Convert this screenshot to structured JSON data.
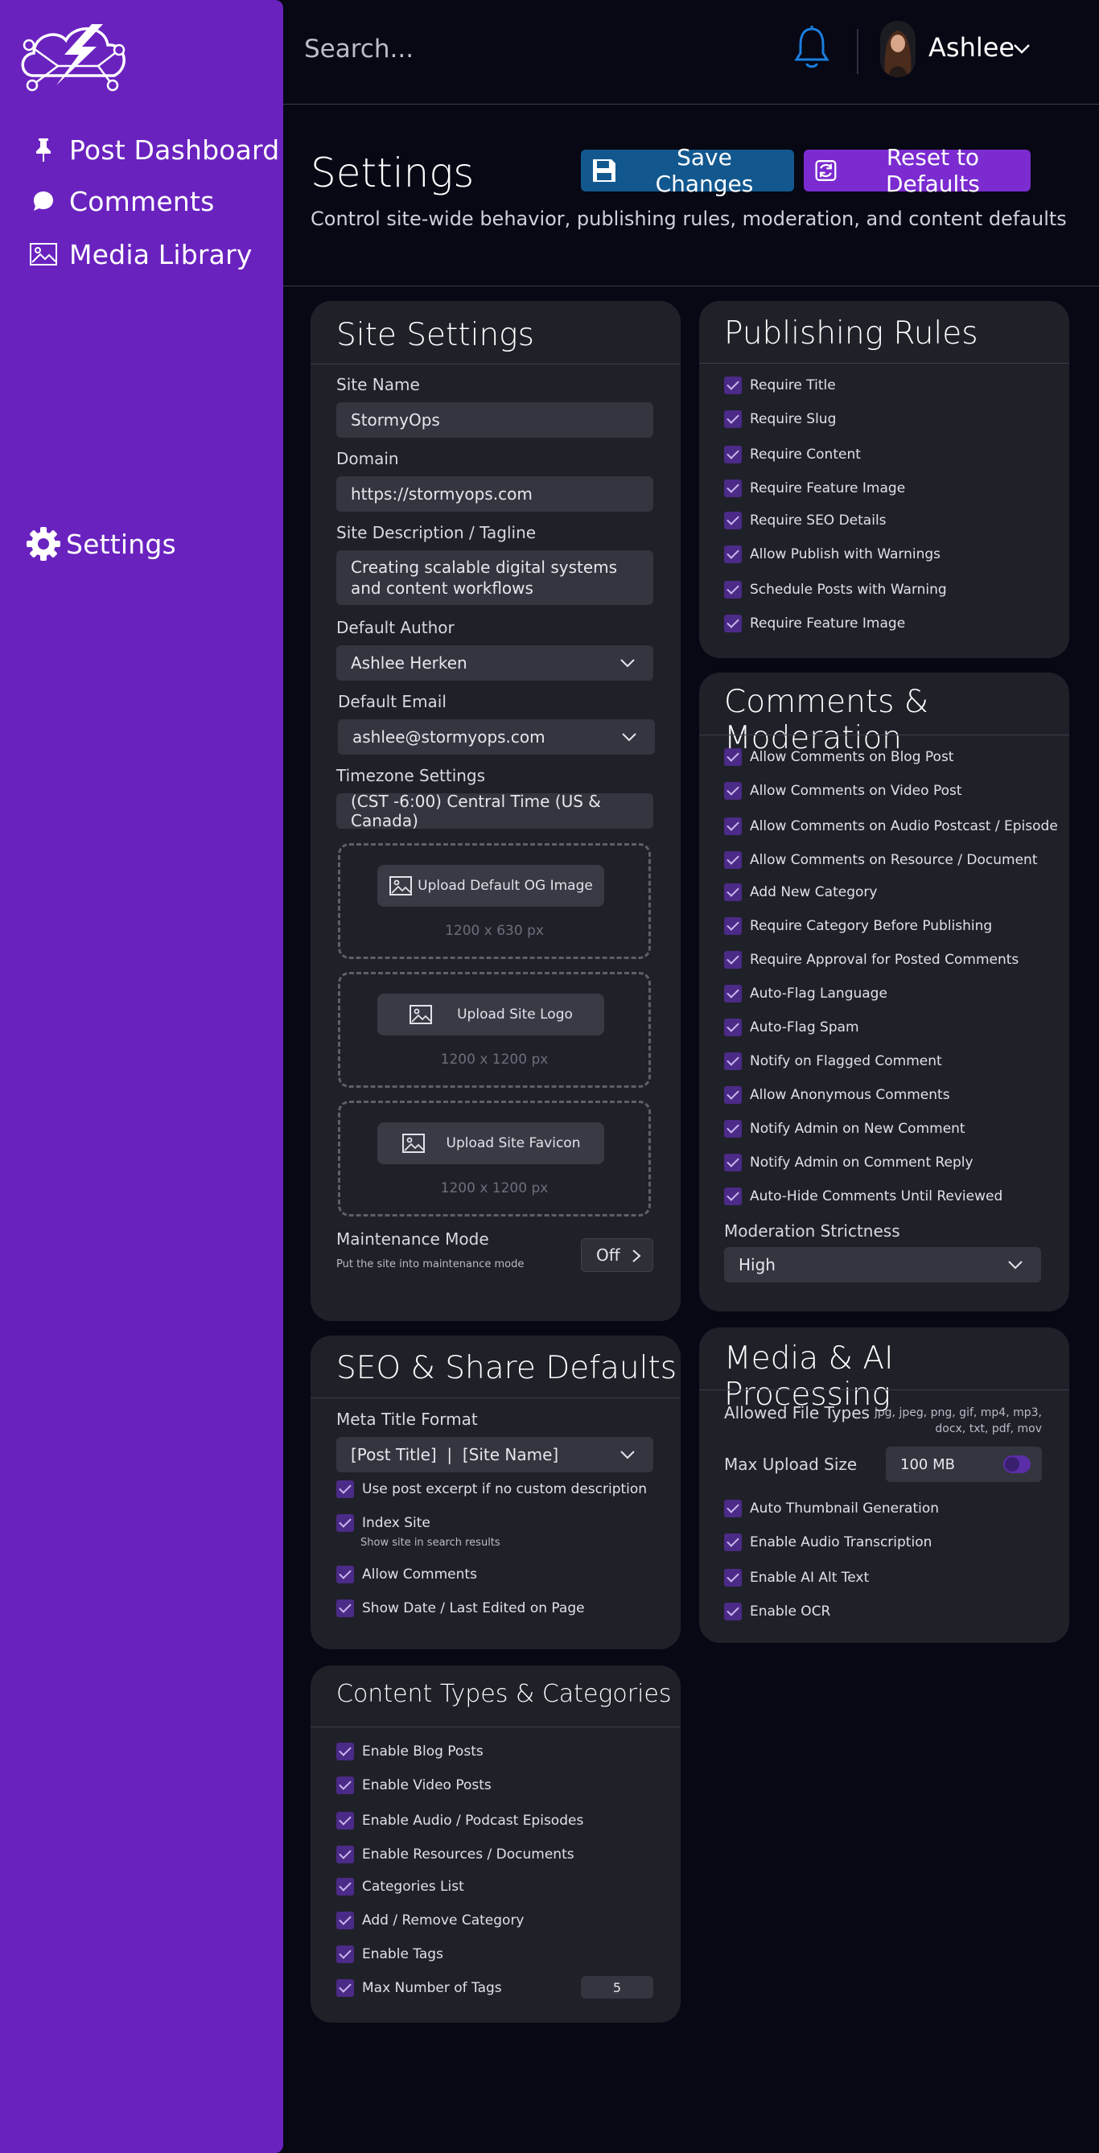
{
  "sidebar": {
    "items": [
      {
        "label": "Post Dashboard",
        "icon": "pin-icon"
      },
      {
        "label": "Comments",
        "icon": "speech-bubble-icon"
      },
      {
        "label": "Media Library",
        "icon": "image-icon"
      },
      {
        "label": "Settings",
        "icon": "gear-icon"
      }
    ]
  },
  "header": {
    "search_placeholder": "Search...",
    "user_name": "Ashlee"
  },
  "page": {
    "title": "Settings",
    "subtitle": "Control site-wide behavior, publishing rules, moderation, and content defaults",
    "save_label": "Save Changes",
    "reset_label": "Reset to Defaults"
  },
  "site_settings": {
    "title": "Site Settings",
    "site_name_label": "Site Name",
    "site_name": "StormyOps",
    "domain_label": "Domain",
    "domain": "https://stormyops.com",
    "description_label": "Site Description / Tagline",
    "description": "Creating scalable digital systems and content workflows",
    "author_label": "Default Author",
    "author": "Ashlee Herken",
    "email_label": "Default Email",
    "email": "ashlee@stormyops.com",
    "timezone_label": "Timezone Settings",
    "timezone": "(CST -6:00) Central Time (US & Canada)",
    "uploads": [
      {
        "label": "Upload Default OG Image",
        "hint": "1200 x 630 px"
      },
      {
        "label": "Upload Site Logo",
        "hint": "1200 x 1200 px"
      },
      {
        "label": "Upload Site Favicon",
        "hint": "1200 x 1200 px"
      }
    ],
    "maintenance_label": "Maintenance Mode",
    "maintenance_hint": "Put the site into maintenance mode",
    "maintenance_value": "Off"
  },
  "publishing_rules": {
    "title": "Publishing Rules",
    "items": [
      "Require Title",
      "Require Slug",
      "Require Content",
      "Require Feature Image",
      "Require SEO Details",
      "Allow Publish with Warnings",
      "Schedule Posts with Warning",
      "Require Feature Image"
    ]
  },
  "comments_moderation": {
    "title": "Comments & Moderation",
    "items": [
      "Allow Comments on Blog Post",
      "Allow Comments on Video Post",
      "Allow Comments on Audio Postcast / Episode",
      "Allow Comments on Resource / Document",
      "Add New Category",
      "Require Category Before Publishing",
      "Require Approval for Posted Comments",
      "Auto-Flag Language",
      "Auto-Flag Spam",
      "Notify on Flagged Comment",
      "Allow Anonymous Comments",
      "Notify Admin on New Comment",
      "Notify Admin on Comment Reply",
      "Auto-Hide Comments Until Reviewed"
    ],
    "strictness_label": "Moderation Strictness",
    "strictness": "High"
  },
  "seo": {
    "title": "SEO & Share Defaults",
    "meta_label": "Meta Title Format",
    "meta_value": "[Post Title]  |  [Site Name]",
    "items": [
      "Use post excerpt if no custom description",
      "Index Site",
      "Allow Comments",
      "Show Date / Last Edited on Page"
    ],
    "index_hint": "Show site in search results"
  },
  "media_ai": {
    "title": "Media & AI Processing",
    "file_types_label": "Allowed File Types",
    "file_types_line1": "jpg, jpeg, png, gif, mp4, mp3,",
    "file_types_line2": "docx, txt, pdf, mov",
    "max_upload_label": "Max Upload Size",
    "max_upload": "100 MB",
    "items": [
      "Auto Thumbnail Generation",
      "Enable Audio Transcription",
      "Enable AI Alt Text",
      "Enable OCR"
    ]
  },
  "content_types": {
    "title": "Content Types & Categories",
    "items": [
      "Enable Blog Posts",
      "Enable Video Posts",
      "Enable Audio / Podcast Episodes",
      "Enable Resources / Documents",
      "Categories List",
      "Add / Remove Category",
      "Enable Tags",
      "Max Number of Tags"
    ],
    "max_tags": "5"
  },
  "colors": {
    "sidebar": "#6a22bf",
    "background": "#070814",
    "card": "#1f2129",
    "save_button": "#12588f",
    "reset_button": "#7b2bd0",
    "checkbox": "#4c2a87",
    "bell": "#1a7fe0"
  }
}
